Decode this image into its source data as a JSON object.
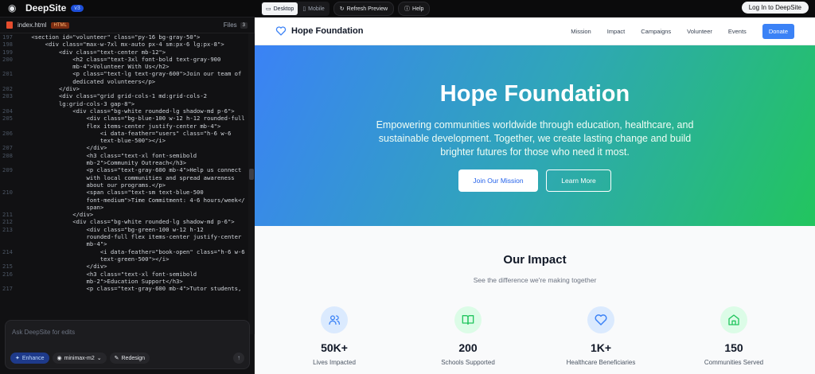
{
  "app": {
    "name": "DeepSite",
    "version": "v3",
    "login_label": "Log In to DeepSite"
  },
  "toolbar": {
    "desktop_label": "Desktop",
    "mobile_label": "Mobile",
    "refresh_label": "Refresh Preview",
    "help_label": "Help"
  },
  "editor": {
    "filename": "index.html",
    "lang": "HTML",
    "files_label": "Files",
    "files_count": "3",
    "lines": [
      {
        "n": "197",
        "t": "    <section id=\"volunteer\" class=\"py-16 bg-gray-50\">"
      },
      {
        "n": "198",
        "t": "        <div class=\"max-w-7xl mx-auto px-4 sm:px-6 lg:px-8\">"
      },
      {
        "n": "199",
        "t": "            <div class=\"text-center mb-12\">"
      },
      {
        "n": "200",
        "t": "                <h2 class=\"text-3xl font-bold text-gray-900\n                mb-4\">Volunteer With Us</h2>"
      },
      {
        "n": "201",
        "t": "                <p class=\"text-lg text-gray-600\">Join our team of\n                dedicated volunteers</p>"
      },
      {
        "n": "202",
        "t": "            </div>"
      },
      {
        "n": "203",
        "t": "            <div class=\"grid grid-cols-1 md:grid-cols-2\n            lg:grid-cols-3 gap-8\">"
      },
      {
        "n": "204",
        "t": "                <div class=\"bg-white rounded-lg shadow-md p-6\">"
      },
      {
        "n": "205",
        "t": "                    <div class=\"bg-blue-100 w-12 h-12 rounded-full\n                    flex items-center justify-center mb-4\">"
      },
      {
        "n": "206",
        "t": "                        <i data-feather=\"users\" class=\"h-6 w-6\n                        text-blue-500\"></i>"
      },
      {
        "n": "207",
        "t": "                    </div>"
      },
      {
        "n": "208",
        "t": "                    <h3 class=\"text-xl font-semibold\n                    mb-2\">Community Outreach</h3>"
      },
      {
        "n": "209",
        "t": "                    <p class=\"text-gray-600 mb-4\">Help us connect\n                    with local communities and spread awareness\n                    about our programs.</p>"
      },
      {
        "n": "210",
        "t": "                    <span class=\"text-sm text-blue-500\n                    font-medium\">Time Commitment: 4-6 hours/week</\n                    span>"
      },
      {
        "n": "211",
        "t": "                </div>"
      },
      {
        "n": "212",
        "t": "                <div class=\"bg-white rounded-lg shadow-md p-6\">"
      },
      {
        "n": "213",
        "t": "                    <div class=\"bg-green-100 w-12 h-12\n                    rounded-full flex items-center justify-center\n                    mb-4\">"
      },
      {
        "n": "214",
        "t": "                        <i data-feather=\"book-open\" class=\"h-6 w-6\n                        text-green-500\"></i>"
      },
      {
        "n": "215",
        "t": "                    </div>"
      },
      {
        "n": "216",
        "t": "                    <h3 class=\"text-xl font-semibold\n                    mb-2\">Education Support</h3>"
      },
      {
        "n": "217",
        "t": "                    <p class=\"text-gray-600 mb-4\">Tutor students,"
      }
    ]
  },
  "chat": {
    "placeholder": "Ask DeepSite for edits",
    "enhance_label": "Enhance",
    "model_label": "minimax-m2",
    "redesign_label": "Redesign"
  },
  "site": {
    "name": "Hope Foundation",
    "nav": [
      "Mission",
      "Impact",
      "Campaigns",
      "Volunteer",
      "Events"
    ],
    "donate_label": "Donate",
    "hero_title": "Hope Foundation",
    "hero_subtitle": "Empowering communities worldwide through education, healthcare, and sustainable development. Together, we create lasting change and build brighter futures for those who need it most.",
    "cta_primary": "Join Our Mission",
    "cta_secondary": "Learn More",
    "impact_title": "Our Impact",
    "impact_subtitle": "See the difference we're making together",
    "stats": [
      {
        "value": "50K+",
        "label": "Lives Impacted",
        "icon": "users-icon",
        "bg": "#dbeafe",
        "color": "#3b82f6"
      },
      {
        "value": "200",
        "label": "Schools Supported",
        "icon": "book-open-icon",
        "bg": "#dcfce7",
        "color": "#22c55e"
      },
      {
        "value": "1K+",
        "label": "Healthcare Beneficiaries",
        "icon": "heart-icon",
        "bg": "#dbeafe",
        "color": "#3b82f6"
      },
      {
        "value": "150",
        "label": "Communities Served",
        "icon": "home-icon",
        "bg": "#dcfce7",
        "color": "#22c55e"
      }
    ]
  }
}
